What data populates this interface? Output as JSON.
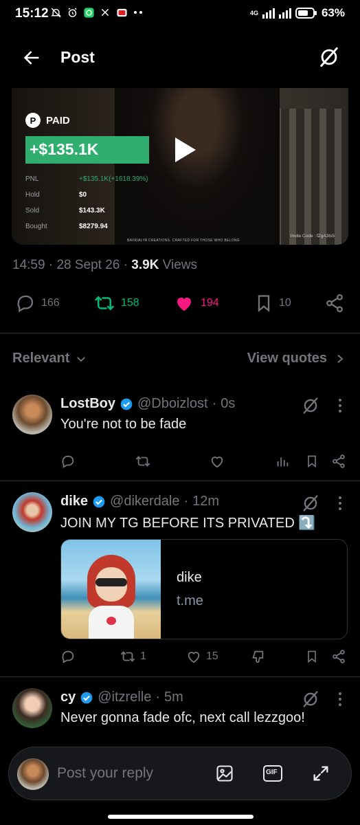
{
  "status_bar": {
    "time": "15:12",
    "network": "4G",
    "battery": "63%",
    "icons": [
      "mute-bell-icon",
      "alarm-icon",
      "whatsapp-icon",
      "x-icon",
      "youtube-icon",
      "more-dots-icon"
    ]
  },
  "header": {
    "title": "Post",
    "back_icon": "arrow-left-icon",
    "grok_icon": "grok-icon"
  },
  "media": {
    "paid_label": "PAID",
    "pnl_value": "+$135.1K",
    "stats": [
      {
        "label": "PNL",
        "value": "+$135.1K(+1618.39%)"
      },
      {
        "label": "Hold",
        "value": "$0"
      },
      {
        "label": "Sold",
        "value": "$143.3K"
      },
      {
        "label": "Bought",
        "value": "$8279.94"
      }
    ],
    "invite": "Invite Code : fZgA3ts5",
    "credit": "BAVRIALYA CREATIONS. CRAFTED FOR THOSE WHO BELONG",
    "play_icon": "play-icon"
  },
  "meta": {
    "time": "14:59",
    "date": "28 Sept 26",
    "views_count": "3.9K",
    "views_label": "Views",
    "sep": "·"
  },
  "actions": {
    "replies": "166",
    "reposts": "158",
    "likes": "194",
    "bookmarks": "10",
    "colors": {
      "repost": "#00ba7c",
      "like": "#f91880",
      "muted": "#71767b"
    }
  },
  "sort": {
    "relevant": "Relevant",
    "view_quotes": "View quotes"
  },
  "replies": [
    {
      "name": "LostBoy",
      "handle": "@Dboizlost",
      "time": "0s",
      "text": "You're not to be fade",
      "replies": "",
      "reposts": "",
      "likes": ""
    },
    {
      "name": "dike",
      "handle": "@dikerdale",
      "time": "12m",
      "text": "JOIN MY TG BEFORE ITS PRIVATED ⤵️",
      "link_title": "dike",
      "link_domain": "t.me",
      "replies": "",
      "reposts": "1",
      "likes": "15"
    },
    {
      "name": "cy",
      "handle": "@itzrelle",
      "time": "5m",
      "text": "Never gonna fade ofc, next call lezzgoo!"
    }
  ],
  "reply_bar": {
    "placeholder": "Post your reply",
    "gif_label": "GIF"
  }
}
